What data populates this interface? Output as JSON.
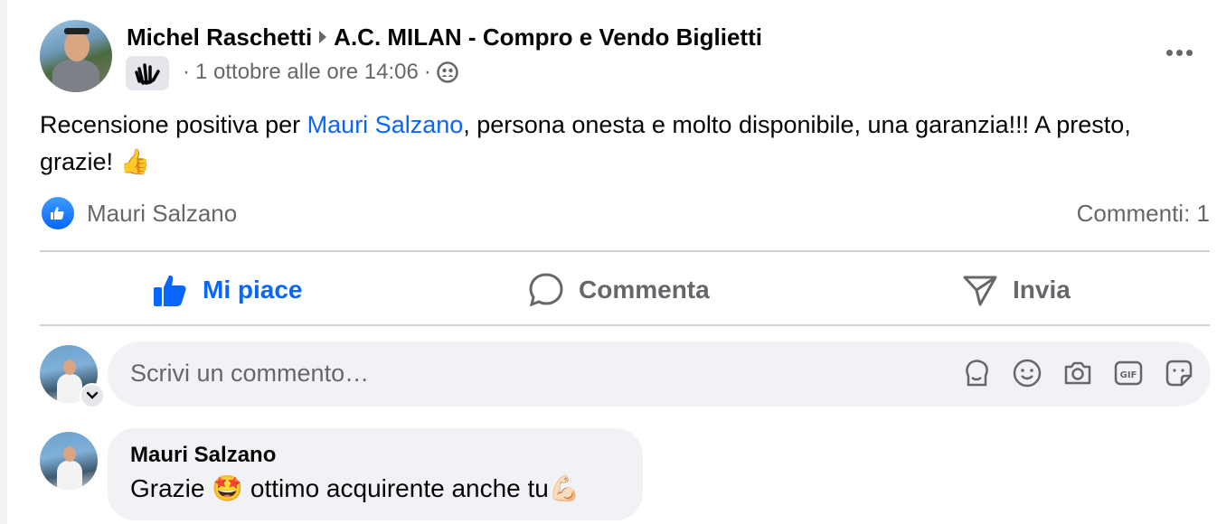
{
  "post": {
    "author": "Michel Raschetti",
    "group": "A.C. MILAN - Compro e Vendo Biglietti",
    "badge_icon": "wave-hand-icon",
    "timestamp": "1 ottobre alle ore 14:06",
    "privacy_icon": "group-members-icon",
    "text_before": "Recensione positiva per ",
    "mention": "Mauri Salzano",
    "text_after": ", persona onesta e molto disponibile, una garanzia!!! A presto, grazie! 👍",
    "reaction_name": "Mauri Salzano",
    "comments_count": "Commenti: 1"
  },
  "actions": {
    "like": "Mi piace",
    "comment": "Commenta",
    "send": "Invia"
  },
  "composer": {
    "placeholder": "Scrivi un commento…",
    "icons": [
      "avatar-sticker-icon",
      "emoji-icon",
      "camera-icon",
      "gif-icon",
      "sticker-icon"
    ]
  },
  "comment": {
    "author": "Mauri Salzano",
    "text": "Grazie 🤩 ottimo acquirente anche tu💪🏻"
  },
  "colors": {
    "accent": "#0866ff",
    "secondary_text": "#65676b",
    "bubble_bg": "#f0f2f5"
  }
}
